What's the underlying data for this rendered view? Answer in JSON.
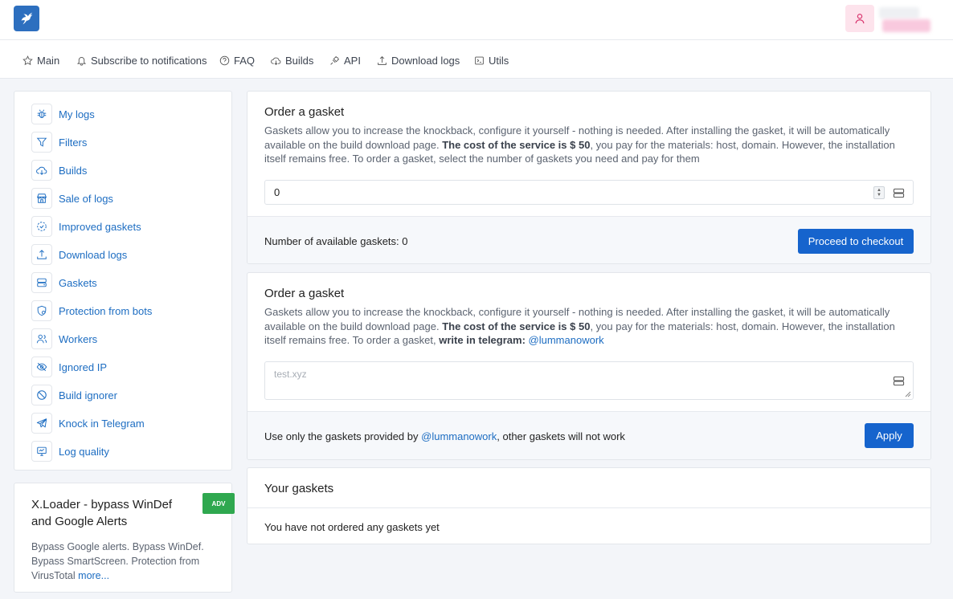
{
  "header": {
    "logo_icon": "hummingbird-icon",
    "user_icon": "user-icon"
  },
  "nav": [
    {
      "label": "Main",
      "icon": "star-icon"
    },
    {
      "label": "Subscribe to notifications",
      "icon": "bell-icon"
    },
    {
      "label": "FAQ",
      "icon": "question-icon"
    },
    {
      "label": "Builds",
      "icon": "cloud-download-icon"
    },
    {
      "label": "API",
      "icon": "plug-icon"
    },
    {
      "label": "Download logs",
      "icon": "upload-icon"
    },
    {
      "label": "Utils",
      "icon": "terminal-icon"
    }
  ],
  "sidebar": {
    "items": [
      {
        "label": "My logs",
        "icon": "bug-icon"
      },
      {
        "label": "Filters",
        "icon": "filter-icon"
      },
      {
        "label": "Builds",
        "icon": "cloud-download-icon"
      },
      {
        "label": "Sale of logs",
        "icon": "store-icon"
      },
      {
        "label": "Improved gaskets",
        "icon": "dashed-circle-check-icon"
      },
      {
        "label": "Download logs",
        "icon": "upload-icon"
      },
      {
        "label": "Gaskets",
        "icon": "server-icon"
      },
      {
        "label": "Protection from bots",
        "icon": "shield-icon"
      },
      {
        "label": "Workers",
        "icon": "users-icon"
      },
      {
        "label": "Ignored IP",
        "icon": "eye-off-icon"
      },
      {
        "label": "Build ignorer",
        "icon": "ban-icon"
      },
      {
        "label": "Knock in Telegram",
        "icon": "telegram-icon"
      },
      {
        "label": "Log quality",
        "icon": "monitor-icon"
      }
    ]
  },
  "adv": {
    "title": "X.Loader - bypass WinDef and Google Alerts",
    "badge": "ADV",
    "text": "Bypass Google alerts. Bypass WinDef. Bypass SmartScreen. Protection from VirusTotal",
    "more": "more..."
  },
  "order1": {
    "title": "Order a gasket",
    "desc_a": "Gaskets allow you to increase the knockback, configure it yourself - nothing is needed. After installing the gasket, it will be automatically available on the build download page.",
    "desc_bold": "The cost of the service is $ 50",
    "desc_b": ", you pay for the materials: host, domain. However, the installation itself remains free. To order a gasket, select the number of gaskets you need and pay for them",
    "quantity": "0",
    "available": "Number of available gaskets: 0",
    "button": "Proceed to checkout"
  },
  "order2": {
    "title": "Order a gasket",
    "desc_a": "Gaskets allow you to increase the knockback, configure it yourself - nothing is needed. After installing the gasket, it will be automatically available on the build download page.",
    "desc_bold": "The cost of the service is $ 50",
    "desc_b": ", you pay for the materials: host, domain. However, the installation itself remains free. To order a gasket,",
    "desc_bold2": "write in telegram:",
    "telegram": "@lummanowork",
    "placeholder": "test.xyz",
    "foot_a": "Use only the gaskets provided by",
    "foot_link": "@lummanowork",
    "foot_b": ", other gaskets will not work",
    "button": "Apply"
  },
  "your": {
    "title": "Your gaskets",
    "empty": "You have not ordered any gaskets yet"
  },
  "colors": {
    "accent": "#1664cd",
    "link": "#1d6dc2",
    "logo": "#2d6fbf",
    "adv_badge": "#2fa84f"
  }
}
